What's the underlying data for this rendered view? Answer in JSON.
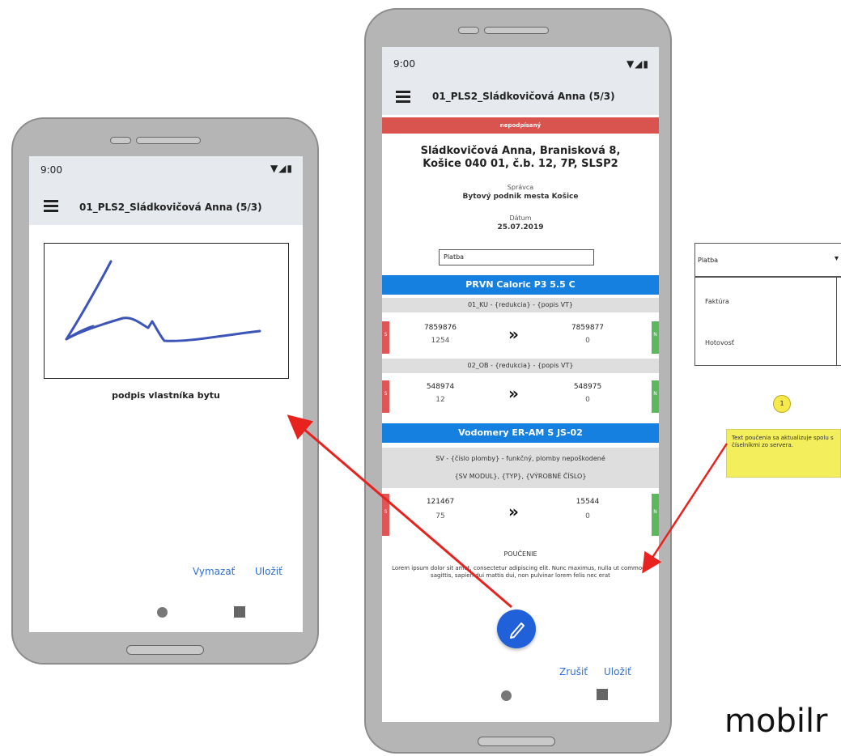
{
  "left_phone": {
    "status_time": "9:00",
    "status_icons": "▼◢▮",
    "title": "01_PLS2_Sládkovičová Anna (5/3)",
    "signature_caption": "podpis vlastníka bytu",
    "clear_label": "Vymazať",
    "save_label": "Uložiť"
  },
  "middle_phone": {
    "status_time": "9:00",
    "status_icons": "▼◢▮",
    "title": "01_PLS2_Sládkovičová Anna (5/3)",
    "banner": "nepodpísaný",
    "address_line1": "Sládkovičová Anna, Branisková 8,",
    "address_line2": "Košice 040 01, č.b. 12, 7P, SLSP2",
    "admin_label": "Správca",
    "admin_value": "Bytový podnik mesta Košice",
    "date_label": "Dátum",
    "date_value": "25.07.2019",
    "payment_select": "Platba",
    "sections": [
      {
        "title": "PRVN Caloric P3 5.5 C",
        "meters": [
          {
            "label": "01_KU - {redukcia} - {popis VT}",
            "old_value": "7859876",
            "old_sub": "1254",
            "new_value": "7859877",
            "new_sub": "0"
          },
          {
            "label": "02_OB - {redukcia} - {popis VT}",
            "old_value": "548974",
            "old_sub": "12",
            "new_value": "548975",
            "new_sub": "0"
          }
        ]
      },
      {
        "title": "Vodomery ER-AM S JS-02",
        "meters": [
          {
            "label": "SV - {číslo plomby} - funkčný, plomby nepoškodené",
            "label2": "{SV MODUL}, {TYP}, {VÝROBNÉ ČÍSLO}",
            "old_value": "121467",
            "old_sub": "75",
            "new_value": "15544",
            "new_sub": "0"
          }
        ]
      }
    ],
    "s_badge": "S",
    "n_badge": "N",
    "arrow": "»",
    "info_title": "POUČENIE",
    "info_text": "Lorem ipsum dolor sit amet, consectetur adipiscing elit. Nunc maximus, nulla ut commodo sagittis, sapien dui mattis dui, non pulvinar lorem felis nec erat",
    "cancel_label": "Zrušiť",
    "save_label": "Uložiť"
  },
  "dropdown": {
    "selected": "Platba",
    "options": [
      "Faktúra",
      "Hotovosť"
    ]
  },
  "annotation": {
    "number": "1",
    "note": "Text poučenia sa aktualizuje spolu s číselníkmi zo servera."
  },
  "footer_text": "mobilr",
  "colors": {
    "banner_red": "#d9534f",
    "section_blue": "#1580e0",
    "fab_blue": "#2060d8",
    "link_blue": "#2e6fd6",
    "signature_stroke": "#3d55b8",
    "arrow_red": "#e8231f",
    "note_yellow": "#f3ee5b",
    "new_badge_green": "#5cb85c",
    "old_badge_red": "#e05555"
  }
}
